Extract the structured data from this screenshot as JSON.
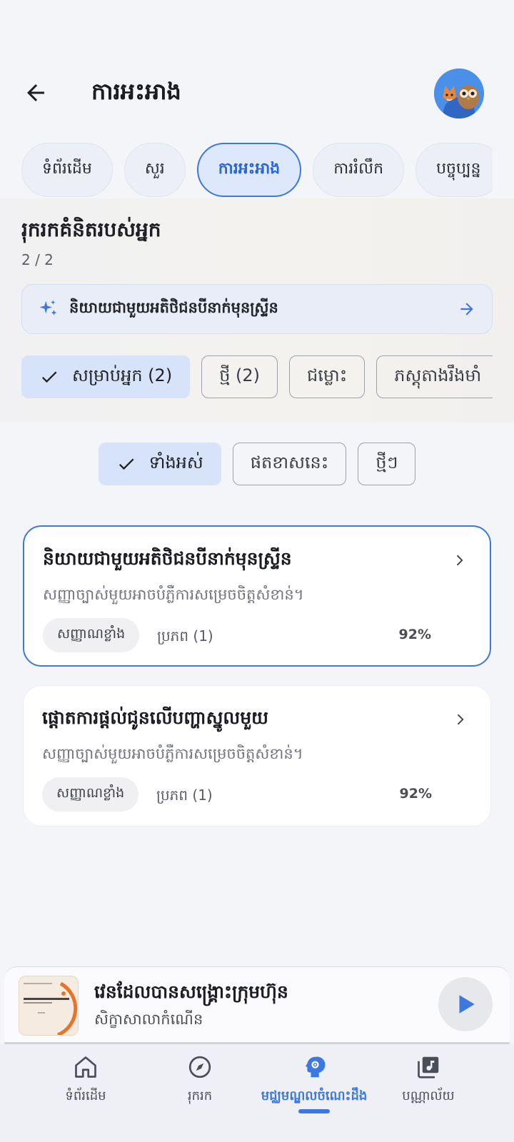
{
  "header": {
    "title": "ការអះអាង",
    "back_icon": "arrow-left-icon",
    "avatar_icon": "fox-owl-avatar"
  },
  "tabs": [
    {
      "label": "ទំព័រដើម",
      "active": false
    },
    {
      "label": "សួរ",
      "active": false
    },
    {
      "label": "ការអះអាង",
      "active": true
    },
    {
      "label": "ការរំលឹក",
      "active": false
    },
    {
      "label": "បច្ចុប្បន្ន",
      "active": false
    }
  ],
  "discover": {
    "title": "រុករកគំនិតរបស់អ្នក",
    "count": "2 / 2",
    "suggestion": "និយាយជាមួយអតិថិជនបីនាក់មុនស្ទ្រីន",
    "filters": [
      {
        "label": "សម្រាប់អ្នក (2)",
        "selected": true
      },
      {
        "label": "ថ្មី (2)",
        "selected": false
      },
      {
        "label": "ជម្លោះ",
        "selected": false
      },
      {
        "label": "ភស្តុតាងរឹងមាំ",
        "selected": false
      }
    ]
  },
  "scope_filters": [
    {
      "label": "ទាំងអស់",
      "selected": true
    },
    {
      "label": "ផតខាសនេះ",
      "selected": false
    },
    {
      "label": "ថ្មីៗ",
      "selected": false
    }
  ],
  "cards": [
    {
      "title": "និយាយជាមួយអតិថិជនបីនាក់មុនស្ទ្រីន",
      "description": "សញ្ញាច្បាស់មួយអាចបំភ្លឺការសម្រេចចិត្តសំខាន់។",
      "badge": "សញ្ញាណខ្លាំង",
      "source": "ប្រភព (1)",
      "percent": "92%",
      "active": true
    },
    {
      "title": "ផ្តោតការផ្តល់ជូនលើបញ្ហាស្នូលមួយ",
      "description": "សញ្ញាច្បាស់មួយអាចបំភ្លឺការសម្រេចចិត្តសំខាន់។",
      "badge": "សញ្ញាណខ្លាំង",
      "source": "ប្រភព (1)",
      "percent": "92%",
      "active": false
    }
  ],
  "player": {
    "title": "វេនដែលបានសង្គ្រោះក្រុមហ៊ុន",
    "subtitle": "សិក្ខាសាលាកំណើន",
    "play_icon": "play-icon"
  },
  "nav": [
    {
      "label": "ទំព័រដើម",
      "icon": "home-icon",
      "active": false
    },
    {
      "label": "រុករក",
      "icon": "compass-icon",
      "active": false
    },
    {
      "label": "មជ្ឈមណ្ឌលចំណេះដឹង",
      "icon": "brain-gear-icon",
      "active": true
    },
    {
      "label": "បណ្ណាល័យ",
      "icon": "music-library-icon",
      "active": false
    }
  ],
  "colors": {
    "accent": "#3d78e0",
    "background": "#f4f5f9",
    "card": "#ffffff"
  }
}
